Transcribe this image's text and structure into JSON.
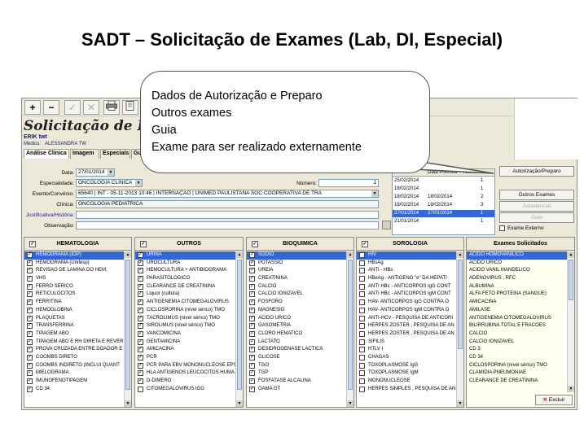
{
  "slide_title": "SADT – Solicitação de Exames (Lab, DI, Especial)",
  "toolbar": {
    "add": "+",
    "remove": "−",
    "edit": "✓",
    "cancel": "✕"
  },
  "form": {
    "title": "Solicitação de Exam",
    "patient": "ERIK twt",
    "medico_label": "Médico:",
    "medico_value": "ALESSANDRA TW"
  },
  "tabs": [
    "Análise Clínica",
    "Imagem",
    "Especiais",
    "Gu"
  ],
  "fields": {
    "data_label": "Data:",
    "data_value": "27/01/2014",
    "especialidade_label": "Especialidade:",
    "especialidade_value": "ONCOLOGIA CLINICA",
    "numero_label": "Número:",
    "numero_value": "1",
    "evento_label": "Evento/Convênio:",
    "evento_value": "65640 | INT - 05-11-2013 10:46 | INTERNAÇÃO | UNIMED PAULISTANA SOC COOPERATIVA DE TRA",
    "clinica_label": "Clínica:",
    "clinica_value": "ONCOLOGIA PEDIATRICA",
    "justificativa_label": "Justificativa/História:",
    "observacao_label": "Observação:"
  },
  "schedule_table": {
    "headers": [
      "Data Prevista",
      "Número"
    ],
    "rows": [
      {
        "data": "25/02/2014",
        "prevista": "",
        "numero": "1"
      },
      {
        "data": "18/02/2014",
        "prevista": "",
        "numero": "1"
      },
      {
        "data": "18/02/2014",
        "prevista": "18/02/2014",
        "numero": "2"
      },
      {
        "data": "18/02/2014",
        "prevista": "18/02/2014",
        "numero": "3"
      },
      {
        "data": "27/01/2014",
        "prevista": "27/01/2014",
        "numero": "1",
        "selected": true
      },
      {
        "data": "21/01/2014",
        "prevista": "",
        "numero": "1"
      }
    ]
  },
  "right_buttons": {
    "autorizacao": "Autorização/Preparo",
    "outros_exames": "Outros Exames",
    "assistencial": "Assistencial",
    "guia": "Guia",
    "exame_externo": "Exame Externo"
  },
  "callout": {
    "lines": [
      "Dados de Autorização e Preparo",
      "Outros exames",
      "Guia",
      "Exame para ser realizado externamente"
    ]
  },
  "panels": {
    "hematologia": {
      "title": "HEMATOLOGIA",
      "items": [
        "HEMOGRAMA (IOP)",
        "HEMOGRAMA (Unifesp)",
        "REVISAO DE LAMINA DO HEM.",
        "VHS",
        "FERRO SERICO",
        "RETICULOCITOS",
        "FERRITINA",
        "HEMOGLOBINA",
        "PLAQUETAS",
        "TRANSFERRINA",
        "TIPAGEM ABO",
        "TIPAGEM ABO E RH DIRETA E REVER",
        "PROVA CRUZADA ENTRE DOADOR E",
        "COOMBS DIRETO",
        "COOMBS INDIRETO (INCLUI QUANT",
        "MIELOGRAMA",
        "IMUNOFENOTIPAGEM",
        "CD 34"
      ]
    },
    "outros": {
      "title": "OUTROS",
      "items": [
        "URINA",
        "UROCULTURA",
        "HEMOCULTURA + ANTIBIOGRAMA",
        "PARASITOLOGICO",
        "CLEARANCE DE CREATININA",
        "Liquor (cultura)",
        "ANTIGENEMIA CITOMEGALOVIRUS",
        "CICLOSPORINA (nível sérico) TMO",
        "TACROLIMUS (nível sérico) TMO",
        "SIROLIMUS (nível sérico) TMO",
        "VANCOMICINA",
        "GENTAMICINA",
        "AMICACINA",
        "PCR",
        "PCR PARA EBV MONONUCLEOSE EPS",
        "HLA ANTIGENOS LEUCOCITOS HUMA",
        "D-DIMERO",
        "CITOMEGALOVIRUS IGG"
      ]
    },
    "bioquimica": {
      "title": "BIOQUIMICA",
      "items": [
        "SODIO",
        "POTASSIO",
        "UREIA",
        "CREATININA",
        "CALCIO",
        "CALCIO IONIZAVEL",
        "FOSFORO",
        "MAGNESIO",
        "ACIDO URICO",
        "GASOMETRIA",
        "CLORO HEMATICO",
        "LACTATO",
        "DESIDROGENASE LACTICA",
        "GLICOSE",
        "TGO",
        "TGP",
        "FOSFATASE ALCALINA",
        "GAMA GT"
      ]
    },
    "sorologia": {
      "title": "SOROLOGIA",
      "items": [
        "HIV",
        "HBsAg",
        "ANTI - HBs",
        "HBeAg    - ANTIGENO \"e\" DA HEPATI",
        "ANTI HBc - ANTICORPOS  IgG CONT",
        "ANTI HBc - ANTICORPOS IgM CONT",
        "HAV- ANTICORPOS IgG CONTRA O",
        "HAV- ANTICORPOS IgM CONTRA O",
        "ANTI-HCV - PESQUISA DE ANTICORI",
        "HERPES ZOSTER , PESQUISA DE AN",
        "HERPES ZOSTER , PESQUISA DE AN",
        "SIFILIS",
        "HTLV I",
        "CHAGAS",
        "TOXOPLASMOSE IgG",
        "TOXOPLASMOSE IgM",
        "MONONUCLEOSE",
        "HERPES SIMPLES , PESQUISA DE AN"
      ]
    },
    "solicitados": {
      "title": "Exames Solicitados",
      "items": [
        "ACIDO HOMOVANILICO",
        "ACIDO URICO",
        "ACIDO VANIL MANDELICO",
        "ADENOVIRUS , RFC",
        "ALBUMINA",
        "ALFA FETO PROTEINA (SANGUE)",
        "AMICACINA",
        "AMILASE",
        "ANTIGENEMIA CITOMEGALOVIRUS",
        "BILIRRUBINA TOTAL E FRACOES",
        "CALCIO",
        "CALCIO IONIZAVEL",
        "CD 3",
        "CD 34",
        "CICLOSPORINA (nível sérico) TMO",
        "CLAMIDIA PNEUMONIAE",
        "CLEARANCE DE CREATININA"
      ],
      "excluir": "Excluir"
    }
  }
}
